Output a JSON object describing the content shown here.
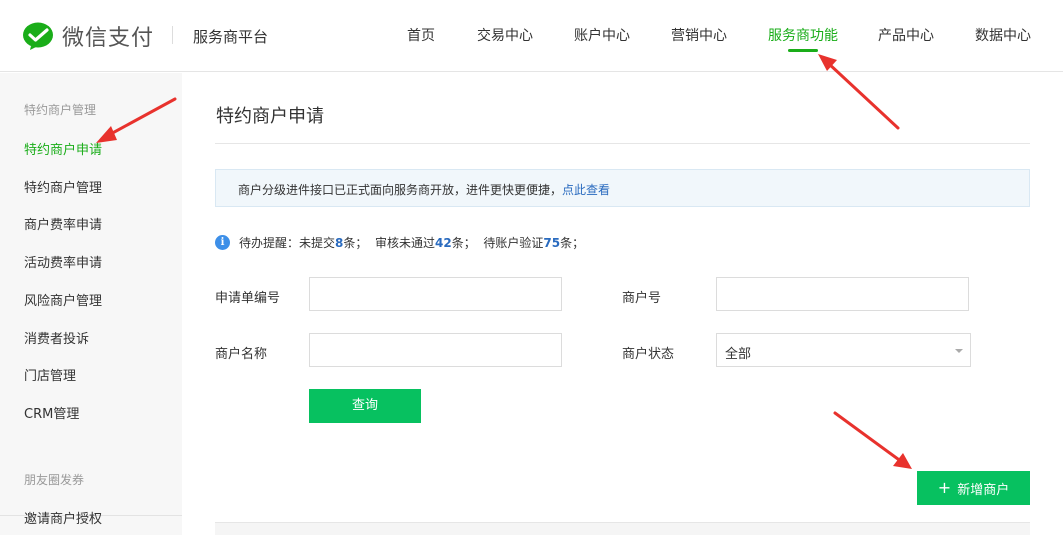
{
  "header": {
    "logo_text": "微信支付",
    "platform": "服务商平台",
    "nav": [
      "首页",
      "交易中心",
      "账户中心",
      "营销中心",
      "服务商功能",
      "产品中心",
      "数据中心"
    ],
    "active_nav": "服务商功能"
  },
  "sidebar": {
    "group1": "特约商户管理",
    "items": [
      "特约商户申请",
      "特约商户管理",
      "商户费率申请",
      "活动费率申请",
      "风险商户管理",
      "消费者投诉",
      "门店管理",
      "CRM管理"
    ],
    "active_item": "特约商户申请",
    "group2": "朋友圈发券",
    "group2_items": [
      "邀请商户授权"
    ]
  },
  "main": {
    "title": "特约商户申请",
    "notice": {
      "text": "商户分级进件接口已正式面向服务商开放，进件更快更便捷，",
      "link": "点此查看"
    },
    "todo": {
      "prefix": "待办提醒：",
      "p1": "未提交",
      "n1": "8",
      "p2": "条；  审核未通过",
      "n2": "42",
      "p3": "条；  待账户验证",
      "n3": "75",
      "p4": "条；"
    },
    "form": {
      "app_no_label": "申请单编号",
      "app_no_value": "",
      "merchant_id_label": "商户号",
      "merchant_id_value": "",
      "merchant_name_label": "商户名称",
      "merchant_name_value": "",
      "status_label": "商户状态",
      "status_value": "全部"
    },
    "query_button": "查询",
    "add_button": "新增商户"
  },
  "colors": {
    "brand_green": "#07c160",
    "nav_active": "#1aad19",
    "link_blue": "#2a6bbf",
    "annotation_red": "#e8322d"
  }
}
